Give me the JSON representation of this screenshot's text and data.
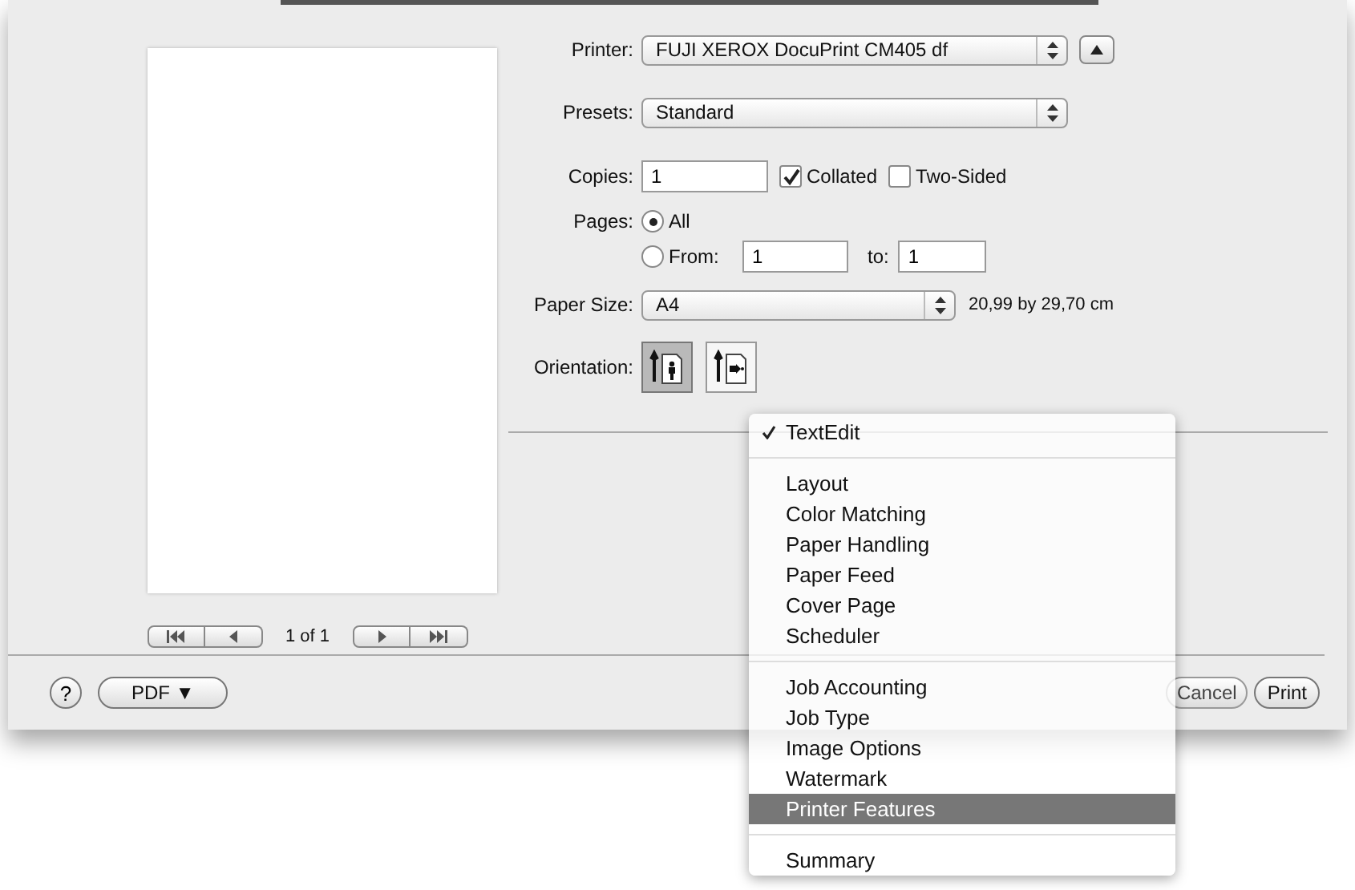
{
  "printer": {
    "label": "Printer:",
    "value": "FUJI XEROX DocuPrint CM405 df"
  },
  "presets": {
    "label": "Presets:",
    "value": "Standard"
  },
  "copies": {
    "label": "Copies:",
    "value": "1"
  },
  "collated": {
    "label": "Collated",
    "checked": true
  },
  "two_sided": {
    "label": "Two-Sided",
    "checked": false
  },
  "pages": {
    "label": "Pages:",
    "options": [
      {
        "kind": "all",
        "label": "All",
        "selected": true
      },
      {
        "kind": "range",
        "label": "From:",
        "selected": false,
        "from": "1",
        "to_label": "to:",
        "to": "1"
      }
    ]
  },
  "paper_size": {
    "label": "Paper Size:",
    "value": "A4",
    "dimensions": "20,99 by 29,70 cm"
  },
  "orientation": {
    "label": "Orientation:",
    "options": [
      {
        "kind": "portrait",
        "selected": true
      },
      {
        "kind": "landscape",
        "selected": false
      }
    ]
  },
  "preview": {
    "page_label": "1 of 1"
  },
  "help": "?",
  "buttons": {
    "pdf": "PDF ▼",
    "cancel": "Cancel",
    "print": "Print"
  },
  "menu": {
    "groups": [
      [
        {
          "label": "TextEdit",
          "checked": true,
          "selected": false
        }
      ],
      [
        {
          "label": "Layout",
          "checked": false,
          "selected": false
        },
        {
          "label": "Color Matching",
          "checked": false,
          "selected": false
        },
        {
          "label": "Paper Handling",
          "checked": false,
          "selected": false
        },
        {
          "label": "Paper Feed",
          "checked": false,
          "selected": false
        },
        {
          "label": "Cover Page",
          "checked": false,
          "selected": false
        },
        {
          "label": "Scheduler",
          "checked": false,
          "selected": false
        }
      ],
      [
        {
          "label": "Job Accounting",
          "checked": false,
          "selected": false
        },
        {
          "label": "Job Type",
          "checked": false,
          "selected": false
        },
        {
          "label": "Image Options",
          "checked": false,
          "selected": false
        },
        {
          "label": "Watermark",
          "checked": false,
          "selected": false
        },
        {
          "label": "Printer Features",
          "checked": false,
          "selected": true
        }
      ],
      [
        {
          "label": "Summary",
          "checked": false,
          "selected": false
        }
      ]
    ]
  }
}
